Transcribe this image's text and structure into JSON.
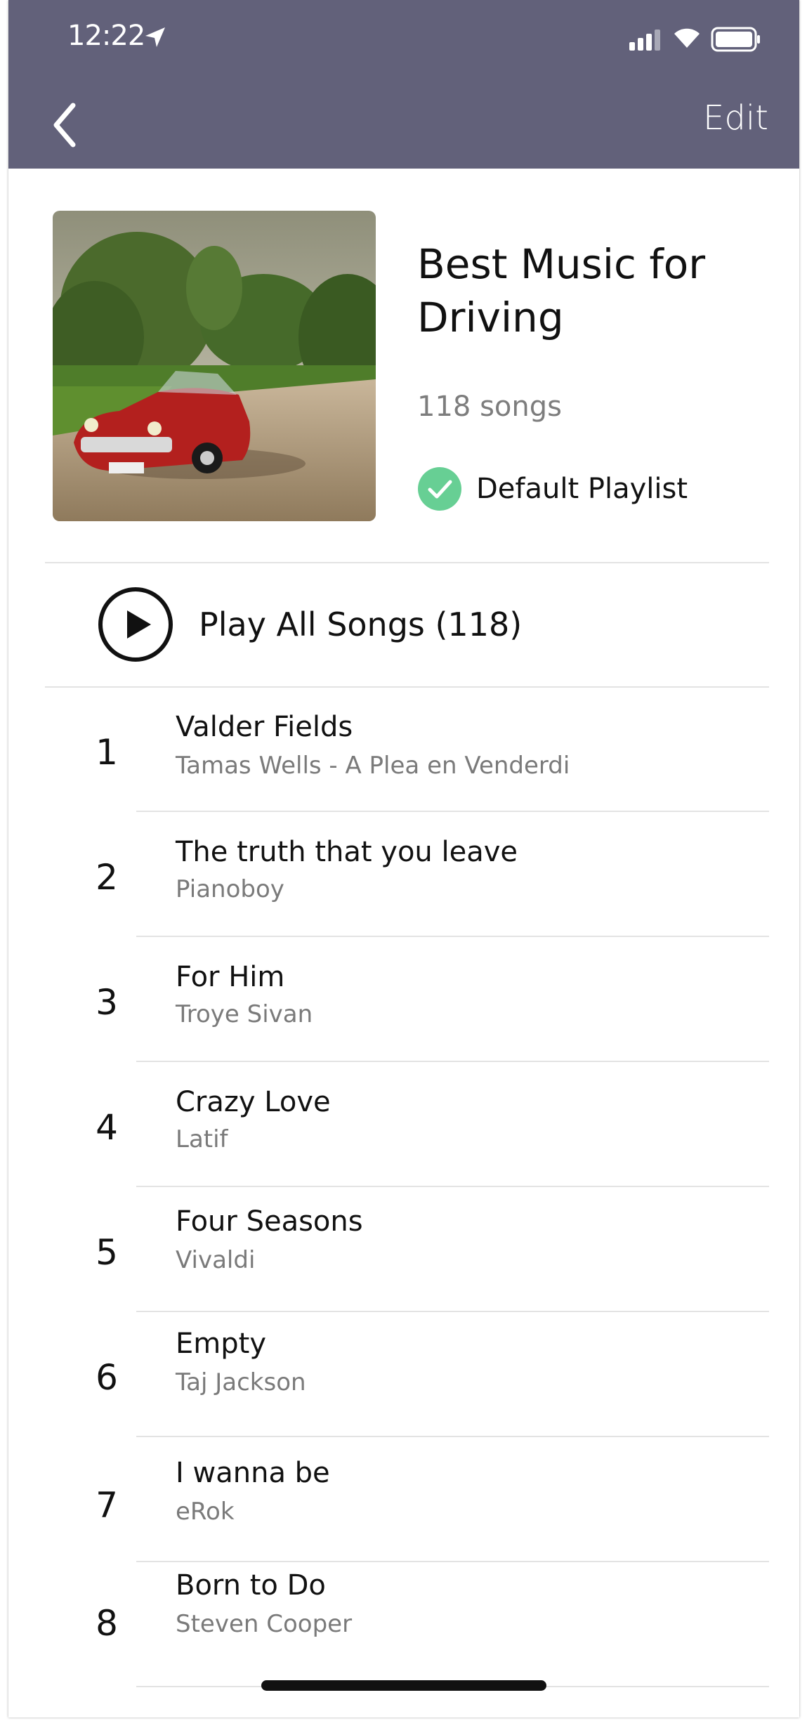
{
  "status_bar": {
    "time": "12:22",
    "icons": [
      "location-arrow-icon",
      "cellular-signal-icon",
      "wifi-icon",
      "battery-icon"
    ]
  },
  "nav_bar": {
    "back_icon": "chevron-left-icon",
    "edit_label": "Edit"
  },
  "colors": {
    "nav_background": "#62617a",
    "check_green": "#67cf94",
    "divider": "#e3e3e3",
    "secondary_text": "#7a7a7a"
  },
  "playlist": {
    "title": "Best Music for Driving",
    "song_count": "118 songs",
    "default_label": "Default Playlist",
    "artwork": "red-classic-convertible-on-dirt-road"
  },
  "play_all": {
    "label": "Play All Songs (118)"
  },
  "songs": [
    {
      "num": "1",
      "title": "Valder Fields",
      "artist": "Tamas Wells - A Plea en Venderdi"
    },
    {
      "num": "2",
      "title": "The truth that you leave",
      "artist": "Pianoboy"
    },
    {
      "num": "3",
      "title": "For Him",
      "artist": "Troye Sivan"
    },
    {
      "num": "4",
      "title": "Crazy Love",
      "artist": "Latif"
    },
    {
      "num": "5",
      "title": "Four Seasons",
      "artist": "Vivaldi"
    },
    {
      "num": "6",
      "title": "Empty",
      "artist": "Taj Jackson"
    },
    {
      "num": "7",
      "title": "I wanna be",
      "artist": "eRok"
    },
    {
      "num": "8",
      "title": "Born to Do",
      "artist": "Steven Cooper"
    }
  ]
}
